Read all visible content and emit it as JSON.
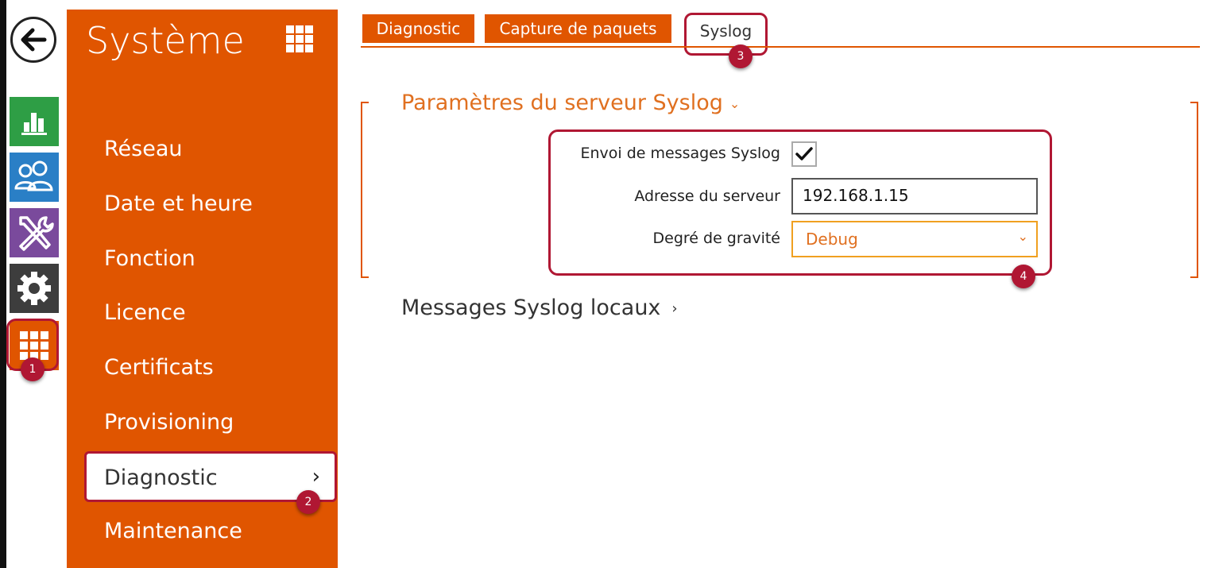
{
  "rail": {
    "icons": [
      "back-arrow-icon",
      "status-icon",
      "users-icon",
      "tools-icon",
      "gear-icon",
      "grid-icon"
    ],
    "badge": "1"
  },
  "menu": {
    "title": "Système",
    "items": [
      "Réseau",
      "Date et heure",
      "Fonction",
      "Licence",
      "Certificats",
      "Provisioning",
      "Diagnostic",
      "Maintenance"
    ],
    "active": "Diagnostic",
    "badge": "2"
  },
  "tabs": {
    "items": [
      "Diagnostic",
      "Capture de paquets",
      "Syslog"
    ],
    "active": "Syslog",
    "badge": "3"
  },
  "section": {
    "title": "Paramètres du serveur Syslog",
    "badge": "4",
    "fields": {
      "send_label": "Envoi de messages Syslog",
      "send_checked": true,
      "server_label": "Adresse du serveur",
      "server_value": "192.168.1.15",
      "severity_label": "Degré de gravité",
      "severity_value": "Debug"
    },
    "local_messages": "Messages Syslog locaux"
  },
  "colors": {
    "accent": "#e05500",
    "highlight": "#b01733",
    "status": "#2e9e45",
    "users": "#2a7fc6",
    "tools": "#7a4a9c",
    "gear": "#3d3d3d"
  }
}
